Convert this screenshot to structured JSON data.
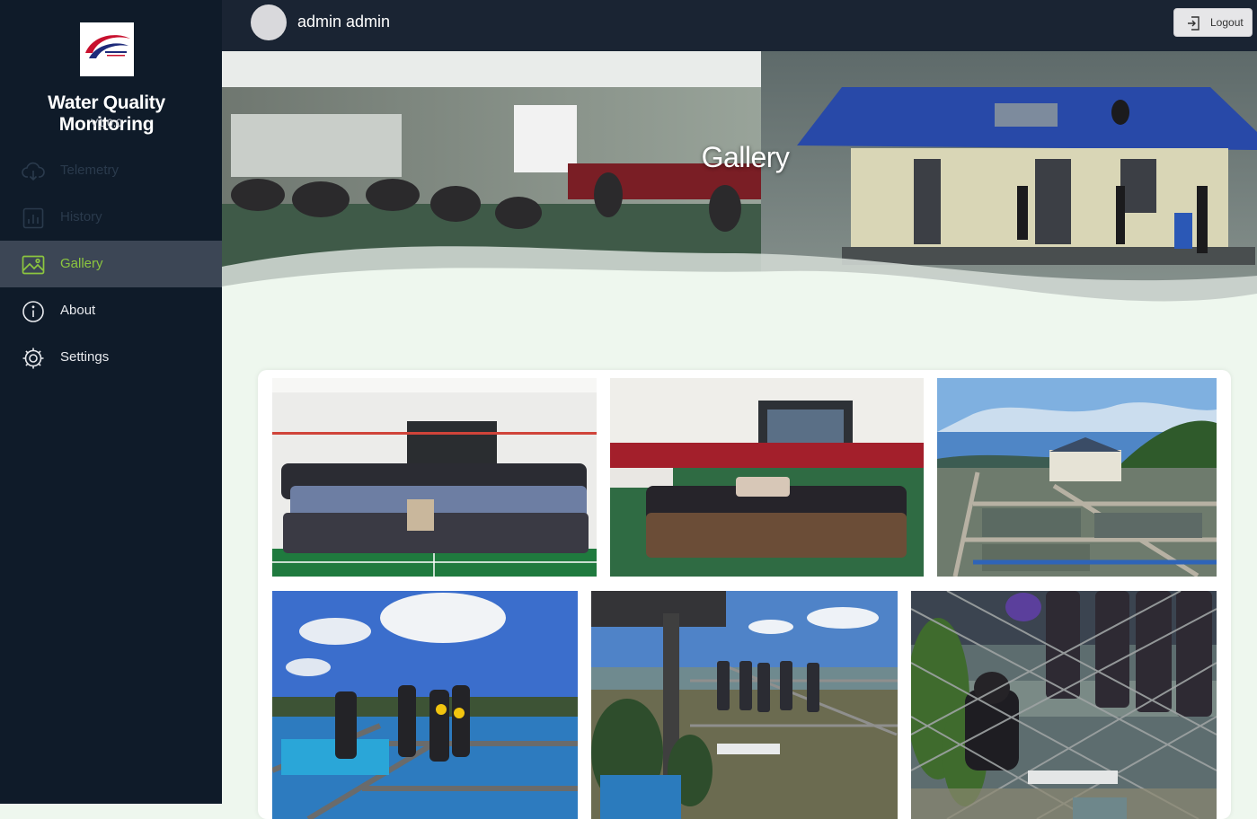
{
  "sidebar": {
    "app_title": "Water Quality Monitoring",
    "version": "V1.0.0",
    "items": [
      {
        "label": "Telemetry",
        "icon": "cloud-download-icon",
        "state": "disabled"
      },
      {
        "label": "History",
        "icon": "bar-chart-icon",
        "state": "disabled"
      },
      {
        "label": "Gallery",
        "icon": "image-icon",
        "state": "active"
      },
      {
        "label": "About",
        "icon": "info-icon",
        "state": "normal"
      },
      {
        "label": "Settings",
        "icon": "gear-icon",
        "state": "normal"
      }
    ]
  },
  "topbar": {
    "user_name": "admin admin",
    "logout_label": "Logout",
    "logout_icon": "logout-icon"
  },
  "hero": {
    "title": "Gallery"
  },
  "colors": {
    "sidebar_bg": "#0f1b29",
    "topbar_bg": "#1a2433",
    "active_accent": "#8cc63f",
    "page_bg": "#eef7ee"
  }
}
